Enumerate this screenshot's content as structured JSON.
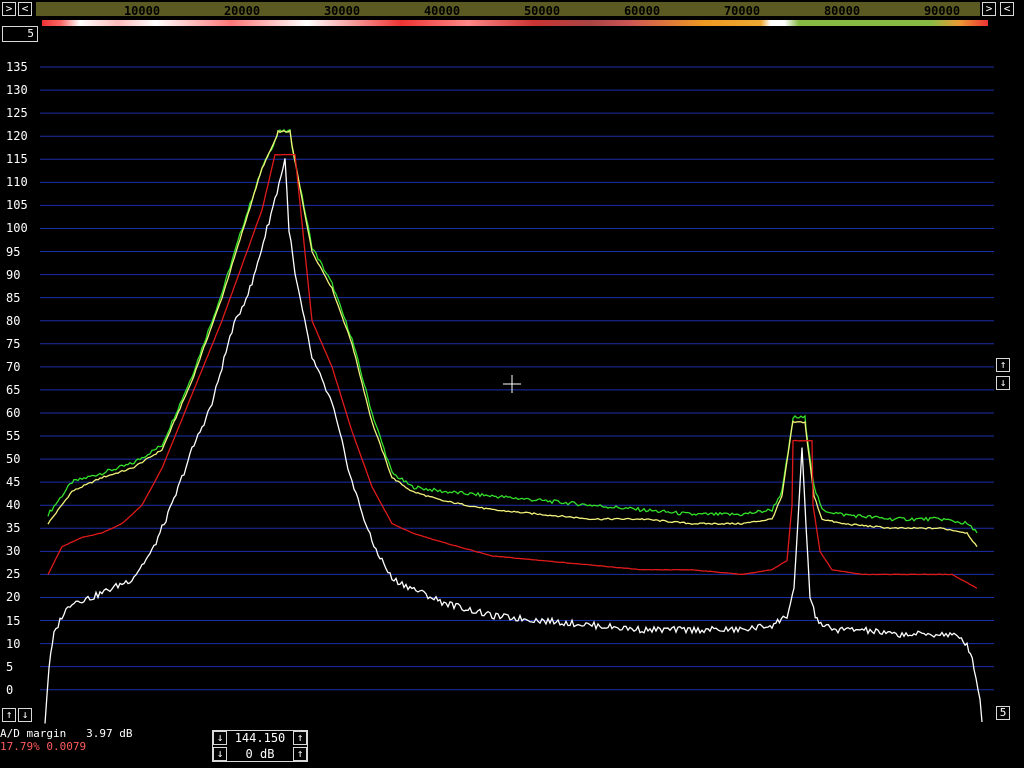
{
  "freq_axis": {
    "ticks": [
      "10000",
      "20000",
      "30000",
      "40000",
      "50000",
      "60000",
      "70000",
      "80000",
      "90000"
    ],
    "tick_values": [
      10000,
      20000,
      30000,
      40000,
      50000,
      60000,
      70000,
      80000,
      90000
    ],
    "min": 0,
    "max": 95000
  },
  "controls": {
    "left_arrow": "<",
    "right_arrow": ">",
    "up_arrow": "↑",
    "down_arrow": "↓",
    "top_small_button": "5",
    "right_small_button": "5"
  },
  "status": {
    "ad_margin": "A/D margin   3.97 dB",
    "level_line": "17.79% 0.0079"
  },
  "center_control": {
    "freq_value": "144.150",
    "gain_value": "0 dB"
  },
  "colors": {
    "background": "#000000",
    "grid": "#1c2fa8",
    "green": "#33e02a",
    "yellow": "#f2f27a",
    "red": "#e01a1a",
    "white": "#ffffff",
    "freq_strip": "#5b5a22"
  },
  "chart_data": {
    "type": "line",
    "x_min": 0,
    "x_max": 95000,
    "y_ticks": [
      "135",
      "130",
      "125",
      "120",
      "115",
      "110",
      "105",
      "100",
      "95",
      "90",
      "85",
      "80",
      "75",
      "70",
      "65",
      "60",
      "55",
      "50",
      "45",
      "40",
      "35",
      "30",
      "25",
      "20",
      "15",
      "10",
      "5",
      "0"
    ],
    "y_tick_values": [
      135,
      130,
      125,
      120,
      115,
      110,
      105,
      100,
      95,
      90,
      85,
      80,
      75,
      70,
      65,
      60,
      55,
      50,
      45,
      40,
      35,
      30,
      25,
      20,
      15,
      10,
      5,
      0
    ],
    "ylim": [
      -7,
      135
    ],
    "grid": true,
    "series": [
      {
        "color": "#33e02a",
        "x": [
          600,
          3000,
          6000,
          9000,
          12000,
          15000,
          18000,
          20000,
          22000,
          23500,
          23600,
          24800,
          25000,
          27000,
          29000,
          31000,
          33000,
          35000,
          37000,
          40000,
          45000,
          50000,
          55000,
          60000,
          65000,
          70000,
          73000,
          74000,
          75000,
          75100,
          76300,
          76400,
          77200,
          78000,
          80000,
          85000,
          90000,
          92500,
          93500
        ],
        "y": [
          38,
          45,
          47,
          49,
          53,
          68,
          86,
          100,
          113,
          120,
          121,
          121,
          118,
          96,
          88,
          76,
          60,
          47,
          44,
          43,
          42,
          41,
          40,
          39,
          38,
          38,
          39,
          43,
          57,
          59,
          59,
          57,
          44,
          39,
          38,
          37,
          37,
          36,
          34
        ]
      },
      {
        "color": "#f2f27a",
        "x": [
          600,
          3000,
          6000,
          9000,
          12000,
          15000,
          18000,
          20000,
          22000,
          23500,
          23600,
          24800,
          25000,
          27000,
          29000,
          31000,
          33000,
          35000,
          37000,
          40000,
          45000,
          50000,
          55000,
          60000,
          65000,
          70000,
          73000,
          74000,
          75000,
          75100,
          76300,
          76400,
          77200,
          78000,
          80000,
          85000,
          90000,
          92500,
          93500
        ],
        "y": [
          36,
          43,
          46,
          48,
          52,
          67,
          85,
          99,
          113,
          120,
          121,
          121,
          118,
          95,
          87,
          75,
          58,
          46,
          43,
          41,
          39,
          38,
          37,
          37,
          36,
          36,
          37,
          42,
          57,
          58,
          58,
          56,
          42,
          37,
          36,
          35,
          35,
          34,
          31
        ]
      },
      {
        "color": "#e01a1a",
        "x": [
          600,
          2000,
          4000,
          6000,
          8000,
          10000,
          12000,
          15000,
          18000,
          20000,
          22000,
          23300,
          23400,
          25200,
          25300,
          27000,
          29000,
          31000,
          33000,
          35000,
          37000,
          40000,
          45000,
          50000,
          55000,
          60000,
          65000,
          70000,
          73000,
          74500,
          75000,
          75100,
          77000,
          77100,
          77800,
          79000,
          82000,
          88000,
          91000,
          93500
        ],
        "y": [
          25,
          31,
          33,
          34,
          36,
          40,
          48,
          64,
          80,
          92,
          104,
          116,
          116,
          116,
          116,
          80,
          70,
          56,
          44,
          36,
          34,
          32,
          29,
          28,
          27,
          26,
          26,
          25,
          26,
          28,
          40,
          54,
          54,
          40,
          30,
          26,
          25,
          25,
          25,
          22
        ]
      },
      {
        "color": "#ffffff",
        "x": [
          300,
          700,
          1200,
          2000,
          3000,
          5000,
          7000,
          9000,
          11000,
          13000,
          15000,
          17000,
          19000,
          21000,
          22500,
          23500,
          24300,
          24700,
          25300,
          27000,
          29000,
          31000,
          33000,
          35000,
          37000,
          40000,
          45000,
          50000,
          55000,
          60000,
          65000,
          70000,
          73000,
          74500,
          75200,
          75600,
          76000,
          76400,
          76800,
          77500,
          79000,
          82000,
          85000,
          88000,
          91000,
          92500,
          93200,
          93800,
          94000
        ],
        "y": [
          -7,
          5,
          12,
          16,
          19,
          20,
          22,
          24,
          30,
          40,
          52,
          62,
          78,
          88,
          100,
          108,
          115,
          100,
          90,
          72,
          62,
          45,
          32,
          24,
          22,
          19,
          16,
          15,
          14,
          13,
          13,
          13,
          14,
          16,
          22,
          36,
          52,
          36,
          20,
          15,
          13,
          13,
          12,
          12,
          12,
          10,
          5,
          -2,
          -7
        ]
      }
    ]
  }
}
